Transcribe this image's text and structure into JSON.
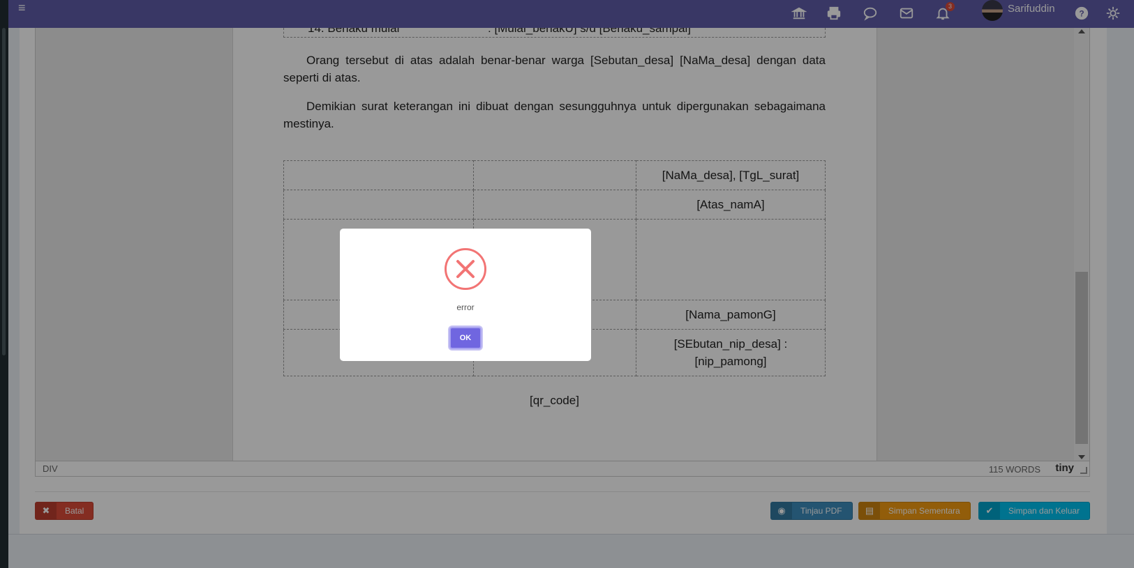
{
  "topbar": {
    "username": "Sarifuddin",
    "notification_count": "3",
    "icons": [
      "bank-icon",
      "print-icon",
      "chat-icon",
      "mail-icon",
      "bell-icon",
      "help-icon",
      "gear-icon"
    ]
  },
  "document": {
    "top_row_left": "14. Berlaku mulai",
    "top_row_right": ": [Mulai_berlakU] s/d [Berlaku_sampai]",
    "para1": "Orang tersebut di atas adalah benar-benar warga [Sebutan_desa] [NaMa_desa] dengan data seperti di atas.",
    "para2": "Demikian surat keterangan ini dibuat dengan sesungguhnya untuk dipergunakan sebagaimana mestinya.",
    "sig_place_date": "[NaMa_desa], [TgL_surat]",
    "sig_on_behalf": "[Atas_namA]",
    "sig_name": "[Nama_pamonG]",
    "sig_nip_line1": "[SEbutan_nip_desa] :",
    "sig_nip_line2": "[nip_pamong]",
    "qr": "[qr_code]"
  },
  "statusbar": {
    "path": "DIV",
    "word_count": "115 WORDS",
    "brand": "tiny"
  },
  "buttons": {
    "cancel": "Batal",
    "preview_pdf": "Tinjau PDF",
    "save_draft": "Simpan Sementara",
    "save_exit": "Simpan dan Keluar"
  },
  "modal": {
    "message": "error",
    "ok_label": "OK"
  },
  "colors": {
    "topbar": "#605ca8",
    "cancel": "#dd4b39",
    "pdf": "#3c8dbc",
    "draft": "#f39c12",
    "exit": "#00c0ef",
    "error": "#f27474",
    "ok": "#7066e0"
  }
}
